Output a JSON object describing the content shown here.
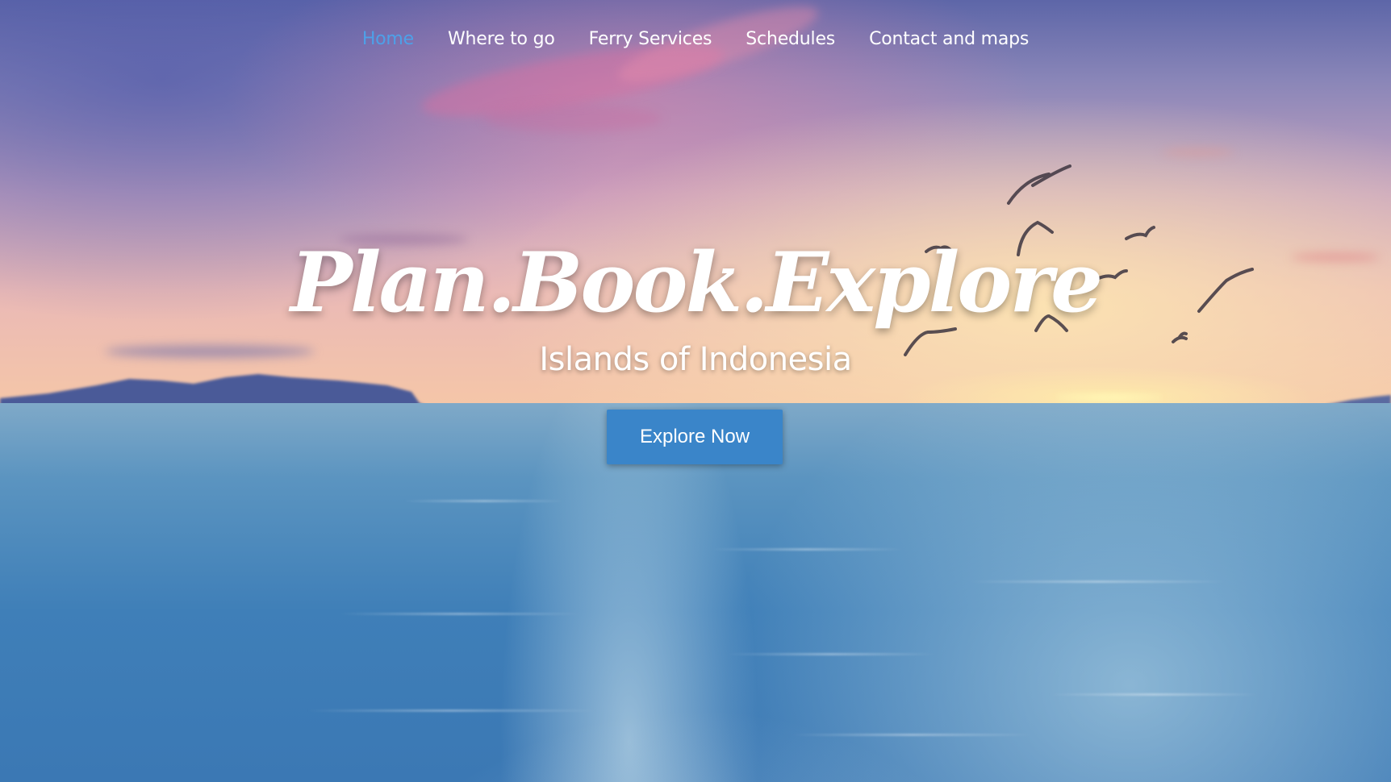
{
  "nav": {
    "items": [
      {
        "label": "Home",
        "active": true
      },
      {
        "label": "Where to go",
        "active": false
      },
      {
        "label": "Ferry Services",
        "active": false
      },
      {
        "label": "Schedules",
        "active": false
      },
      {
        "label": "Contact and maps",
        "active": false
      }
    ],
    "active_color": "#4ea0e8",
    "text_color": "#ffffff"
  },
  "hero": {
    "title": "Plan.Book.Explore",
    "subtitle": "Islands of Indonesia",
    "cta_label": "Explore Now",
    "cta_color": "#3a85c9"
  }
}
